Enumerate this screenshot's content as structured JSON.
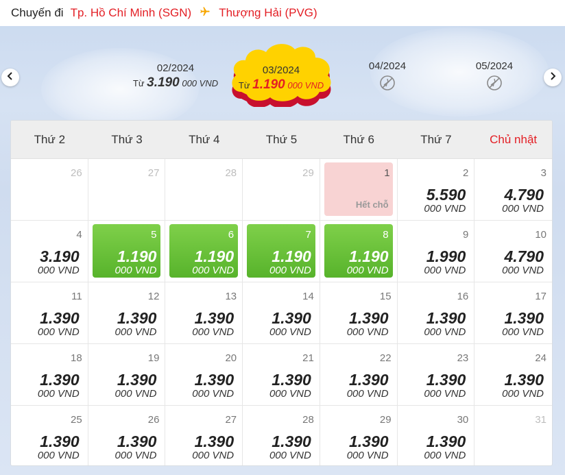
{
  "header": {
    "label": "Chuyến đi",
    "origin": "Tp. Hồ Chí Minh (SGN)",
    "destination": "Thượng Hải (PVG)"
  },
  "months": [
    {
      "name": "02/2024",
      "from_label": "Từ",
      "price": "3.190",
      "unit": "000 VND",
      "active": false,
      "available": true
    },
    {
      "name": "03/2024",
      "from_label": "Từ",
      "price": "1.190",
      "unit": "000 VND",
      "active": true,
      "available": true
    },
    {
      "name": "04/2024",
      "active": false,
      "available": false,
      "icon": "no-flight-icon"
    },
    {
      "name": "05/2024",
      "active": false,
      "available": false,
      "icon": "no-flight-icon"
    }
  ],
  "weekdays": [
    "Thứ 2",
    "Thứ 3",
    "Thứ 4",
    "Thứ 5",
    "Thứ 6",
    "Thứ 7",
    "Chủ nhật"
  ],
  "sold_out_label": "Hết chỗ",
  "unit": "000 VND",
  "days": [
    {
      "day": "26",
      "type": "out"
    },
    {
      "day": "27",
      "type": "out"
    },
    {
      "day": "28",
      "type": "out"
    },
    {
      "day": "29",
      "type": "out"
    },
    {
      "day": "1",
      "type": "soldout"
    },
    {
      "day": "2",
      "type": "normal",
      "price": "5.590"
    },
    {
      "day": "3",
      "type": "normal",
      "price": "4.790"
    },
    {
      "day": "4",
      "type": "normal",
      "price": "3.190"
    },
    {
      "day": "5",
      "type": "cheap",
      "price": "1.190"
    },
    {
      "day": "6",
      "type": "cheap",
      "price": "1.190"
    },
    {
      "day": "7",
      "type": "cheap",
      "price": "1.190"
    },
    {
      "day": "8",
      "type": "cheap",
      "price": "1.190"
    },
    {
      "day": "9",
      "type": "normal",
      "price": "1.990"
    },
    {
      "day": "10",
      "type": "normal",
      "price": "4.790"
    },
    {
      "day": "11",
      "type": "normal",
      "price": "1.390"
    },
    {
      "day": "12",
      "type": "normal",
      "price": "1.390"
    },
    {
      "day": "13",
      "type": "normal",
      "price": "1.390"
    },
    {
      "day": "14",
      "type": "normal",
      "price": "1.390"
    },
    {
      "day": "15",
      "type": "normal",
      "price": "1.390"
    },
    {
      "day": "16",
      "type": "normal",
      "price": "1.390"
    },
    {
      "day": "17",
      "type": "normal",
      "price": "1.390"
    },
    {
      "day": "18",
      "type": "normal",
      "price": "1.390"
    },
    {
      "day": "19",
      "type": "normal",
      "price": "1.390"
    },
    {
      "day": "20",
      "type": "normal",
      "price": "1.390"
    },
    {
      "day": "21",
      "type": "normal",
      "price": "1.390"
    },
    {
      "day": "22",
      "type": "normal",
      "price": "1.390"
    },
    {
      "day": "23",
      "type": "normal",
      "price": "1.390"
    },
    {
      "day": "24",
      "type": "normal",
      "price": "1.390"
    },
    {
      "day": "25",
      "type": "normal",
      "price": "1.390"
    },
    {
      "day": "26",
      "type": "normal",
      "price": "1.390"
    },
    {
      "day": "27",
      "type": "normal",
      "price": "1.390"
    },
    {
      "day": "28",
      "type": "normal",
      "price": "1.390"
    },
    {
      "day": "29",
      "type": "normal",
      "price": "1.390"
    },
    {
      "day": "30",
      "type": "normal",
      "price": "1.390"
    },
    {
      "day": "31",
      "type": "out"
    }
  ],
  "colors": {
    "accent_red": "#e31e24",
    "plane_yellow": "#f7a600",
    "cheap_green": "#57b32b",
    "soldout_pink": "#f8d3d3",
    "active_cloud_yellow": "#ffd200"
  }
}
